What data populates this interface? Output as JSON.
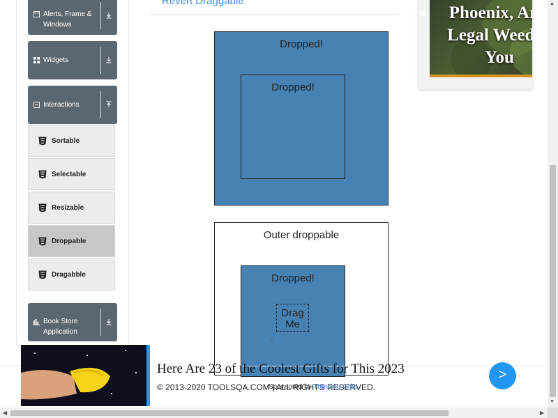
{
  "sidebar": {
    "groups": [
      {
        "label_line1": "Alerts, Frame &",
        "label_line2": "Windows",
        "icon": "window-icon",
        "arrow": "download-arrow-icon"
      },
      {
        "label": "Widgets",
        "icon": "grid-icon",
        "arrow": "download-arrow-icon"
      },
      {
        "label": "Interactions",
        "icon": "collapse-icon",
        "arrow": "upload-arrow-icon"
      },
      {
        "label_line1": "Book Store",
        "label_line2": "Application",
        "icon": "book-chart-icon",
        "arrow": "download-arrow-icon"
      }
    ],
    "items": [
      {
        "label": "Sortable",
        "icon": "html5-icon",
        "active": false
      },
      {
        "label": "Selectable",
        "icon": "html5-icon",
        "active": false
      },
      {
        "label": "Resizable",
        "icon": "html5-icon",
        "active": false
      },
      {
        "label": "Droppable",
        "icon": "html5-icon",
        "active": true
      },
      {
        "label": "Dragabble",
        "icon": "html5-icon",
        "active": false
      }
    ]
  },
  "main": {
    "revert_link": "Revert Draggable",
    "outer_box_1_caption": "Dropped!",
    "inner_box_1_caption": "Dropped!",
    "outer_box_2_caption": "Outer droppable",
    "inner_box_2_caption": "Dropped!",
    "drag_me": {
      "line1": "Drag",
      "line2": "Me"
    },
    "tiny_mark": "✓"
  },
  "right_ad": {
    "line1": "Phoenix, Ariz",
    "line2": "Legal Weed D",
    "line3": "You"
  },
  "footer": {
    "copyright": "© 2013-2020 TOOLSQA.COM | ALL RIGHTS RESERVED.",
    "sponsored_prefix": "Sponsored by",
    "sponsored_brand": "Trending Gifts"
  },
  "bottom_ad": {
    "headline": "Here Are 23 of the Coolest Gifts for This 2023",
    "next_label": ">"
  },
  "colors": {
    "droppable_blue": "#4682b4",
    "sidebar_header": "#5b6770",
    "accent_blue": "#2196f3",
    "link_blue": "#3b8bd6"
  }
}
